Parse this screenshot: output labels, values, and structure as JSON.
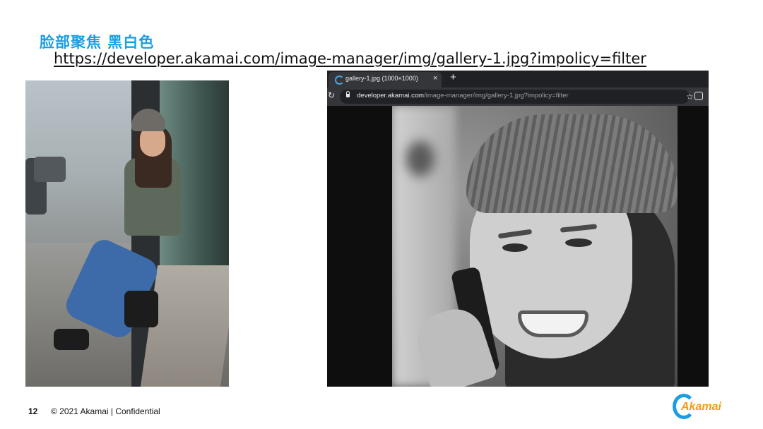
{
  "slide": {
    "title": "脸部聚焦  黑白色",
    "url": "https://developer.akamai.com/image-manager/img/gallery-1.jpg?impolicy=filter"
  },
  "browser": {
    "tab": {
      "title": "gallery-1.jpg (1000×1000)",
      "close_icon": "×"
    },
    "new_tab_icon": "+",
    "reload_icon": "↻",
    "address": {
      "host": "developer.akamai.com",
      "path": "/image-manager/img/gallery-1.jpg?impolicy=filter"
    },
    "bookmark_icon": "☆",
    "theme": {
      "tabbar": "#202124",
      "toolbar": "#35363a",
      "text": "#e8eaed"
    }
  },
  "footer": {
    "page_number": "12",
    "copyright": "© 2021 Akamai | Confidential",
    "logo_text": "Akamai"
  },
  "colors": {
    "title": "#1a9ee0",
    "logo_orange": "#f39c12",
    "logo_blue": "#1a9ee0"
  }
}
